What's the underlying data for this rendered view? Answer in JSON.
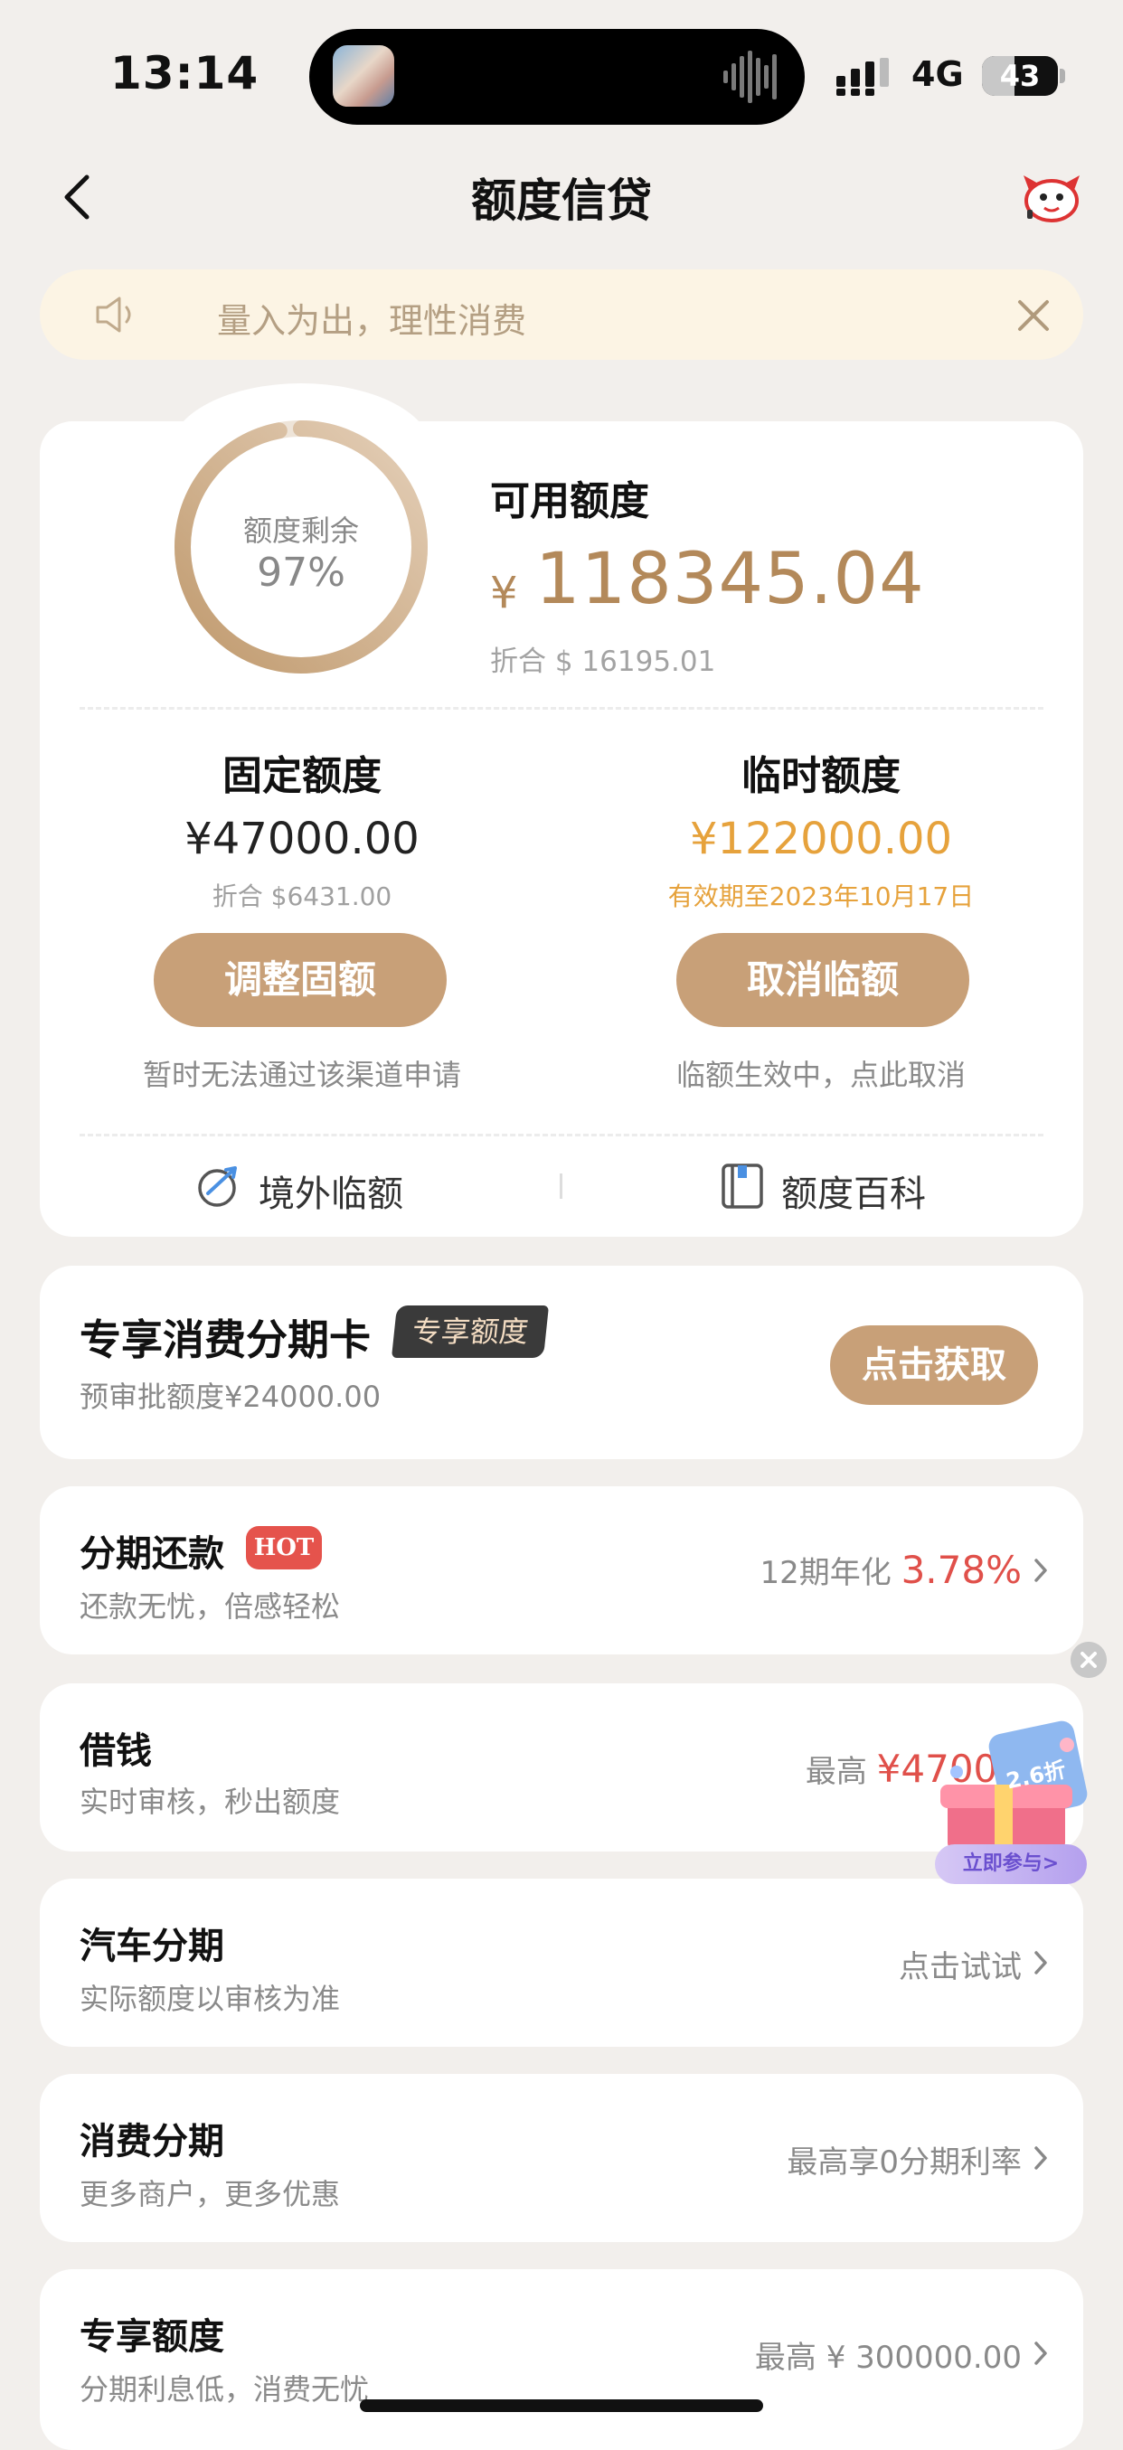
{
  "status_bar": {
    "time": "13:14",
    "network": "4G",
    "battery": "43",
    "battery_level": 0.43
  },
  "nav": {
    "title": "额度信贷"
  },
  "notice": {
    "text": "量入为出，理性消费"
  },
  "credit": {
    "ring_label": "额度剩余",
    "ring_value": "97%",
    "ring_fraction": 0.97,
    "available_label": "可用额度",
    "currency": "¥",
    "available_amount": "118345.04",
    "available_usd": "折合 $ 16195.01",
    "fixed": {
      "title": "固定额度",
      "amount": "¥47000.00",
      "usd": "折合 $6431.00",
      "button": "调整固额",
      "note": "暂时无法通过该渠道申请"
    },
    "temp": {
      "title": "临时额度",
      "amount": "¥122000.00",
      "validity": "有效期至2023年10月17日",
      "button": "取消临额",
      "note": "临额生效中，点此取消"
    },
    "links": {
      "overseas": "境外临额",
      "wiki": "额度百科"
    }
  },
  "promo": {
    "title": "专享消费分期卡",
    "tag": "专享额度",
    "sub": "预审批额度¥24000.00",
    "button": "点击获取"
  },
  "items": [
    {
      "title": "分期还款",
      "badge": "HOT",
      "sub": "还款无忧，倍感轻松",
      "right_prefix": "12期年化 ",
      "right_value": "3.78%"
    },
    {
      "title": "借钱",
      "sub": "实时审核，秒出额度",
      "right_prefix": "最高 ",
      "right_value": "¥47000"
    },
    {
      "title": "汽车分期",
      "sub": "实际额度以审核为准",
      "right_prefix": "点击试试",
      "right_value": ""
    },
    {
      "title": "消费分期",
      "sub": "更多商户，更多优惠",
      "right_prefix": "最高享0分期利率",
      "right_value": ""
    },
    {
      "title": "专享额度",
      "sub": "分期利息低，消费无忧",
      "right_prefix": "最高 ¥ 300000.00",
      "right_value": ""
    }
  ],
  "float_ad": {
    "discount": "2.6折",
    "cta": "立即参与>"
  },
  "colors": {
    "gold": "#c8a078",
    "amount_gold": "#b3895a",
    "temp_orange": "#e6a23c",
    "red": "#e0504a"
  }
}
